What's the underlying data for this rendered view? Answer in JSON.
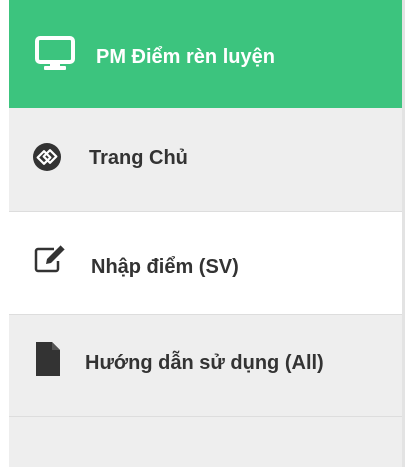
{
  "sidebar": {
    "brand": {
      "title": "PM Điểm rèn luyện",
      "icon": "monitor-icon"
    },
    "items": [
      {
        "label": "Trang Chủ",
        "icon": "link-circle-icon"
      },
      {
        "label": "Nhập điểm (SV)",
        "icon": "edit-icon"
      },
      {
        "label": "Hướng dẫn sử dụng (All)",
        "icon": "document-icon"
      }
    ]
  },
  "colors": {
    "brand_bg": "#3cc47e",
    "item_bg": "#eeeeee",
    "text": "#333333"
  }
}
